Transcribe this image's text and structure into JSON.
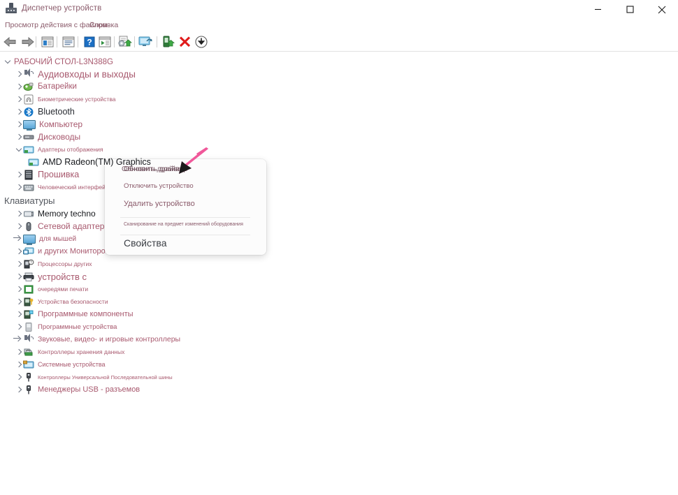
{
  "window": {
    "title": "Диспетчер устройств",
    "icon": "device-manager-icon",
    "controls": {
      "minimize": "–",
      "maximize": "□",
      "close": "✕"
    }
  },
  "menubar": {
    "items": [
      {
        "label": "Просмотр действия с файлом"
      },
      {
        "label": "Справка"
      }
    ]
  },
  "toolbar": {
    "buttons": [
      {
        "name": "back-button",
        "icon": "back-arrow-icon"
      },
      {
        "name": "forward-button",
        "icon": "forward-arrow-icon"
      },
      {
        "name": "show-hidden-devices-button",
        "icon": "list-view-icon"
      },
      {
        "name": "properties-button",
        "icon": "properties-icon"
      },
      {
        "name": "help-button",
        "icon": "help-question-icon"
      },
      {
        "name": "devices-by-type-button",
        "icon": "devices-list-icon"
      },
      {
        "name": "update-driver-button",
        "icon": "update-driver-icon"
      },
      {
        "name": "scan-hardware-button",
        "icon": "scan-monitor-icon"
      },
      {
        "name": "disable-device-button",
        "icon": "disable-device-icon"
      },
      {
        "name": "uninstall-device-button",
        "icon": "red-x-icon"
      },
      {
        "name": "download-button",
        "icon": "download-circle-icon"
      }
    ]
  },
  "tree": {
    "root": {
      "label": "РАБОЧИЙ СТОЛ-L3N388G",
      "expanded": true
    },
    "items": [
      {
        "label": "Аудиовходы и выходы",
        "icon": "speaker-icon",
        "marker": "chevron-right",
        "size": 13.5,
        "color": "#a8596e"
      },
      {
        "label": "Батарейки",
        "icon": "battery-icon",
        "marker": "chevron-right",
        "size": 11.5,
        "color": "#a8596e"
      },
      {
        "label": "Биометрические устройства",
        "icon": "fingerprint-icon",
        "marker": "chevron-right",
        "size": 8.5,
        "color": "#a8596e"
      },
      {
        "label": "Bluetooth",
        "icon": "bluetooth-icon",
        "marker": "chevron-right",
        "size": 12.5,
        "color": "#2a2d33"
      },
      {
        "label": "Компьютер",
        "icon": "computer-icon",
        "marker": "chevron-right",
        "size": 12,
        "color": "#a8596e"
      },
      {
        "label": "Дисководы",
        "icon": "disk-drive-icon",
        "marker": "chevron-right",
        "size": 12,
        "color": "#a8596e"
      },
      {
        "label": "Адаптеры отображения",
        "icon": "display-adapter-icon",
        "marker": "chevron-down",
        "size": 8.5,
        "color": "#a8596e"
      },
      {
        "label": "AMD Radeon(TM) Graphics",
        "icon": "display-adapter-icon",
        "marker": "none",
        "size": 12.5,
        "color": "#16181c",
        "selected": true
      },
      {
        "label": "Прошивка",
        "icon": "firmware-icon",
        "marker": "chevron-right",
        "size": 12.5,
        "color": "#a8596e"
      },
      {
        "label": "Человеческий интерфейс",
        "icon": "hid-icon",
        "marker": "chevron-right",
        "size": 8.5,
        "color": "#a8596e"
      },
      {
        "label": "Клавиатуры",
        "icon": "none",
        "marker": "none",
        "size": 13,
        "color": "#54585f"
      },
      {
        "label": "Memory techno",
        "icon": "memory-icon",
        "marker": "chevron-right",
        "size": 12,
        "color": "#16181c"
      },
      {
        "label": "Сетевой адаптер",
        "icon": "mouse-icon",
        "marker": "chevron-right",
        "size": 12,
        "color": "#a8596e"
      },
      {
        "label": "для мышей",
        "icon": "monitor-icon",
        "marker": "double-chevron",
        "size": 10,
        "color": "#a8596e"
      },
      {
        "label": "и других Мониторов",
        "icon": "monitor-blue-icon",
        "marker": "chevron-right",
        "size": 11,
        "color": "#a8596e"
      },
      {
        "label": "Процессоры других",
        "icon": "processor-icon",
        "marker": "chevron-right",
        "size": 8.5,
        "color": "#a8596e"
      },
      {
        "label": "устройств с",
        "icon": "printer-icon",
        "marker": "chevron-right",
        "size": 13,
        "color": "#a8596e"
      },
      {
        "label": "очередями печати",
        "icon": "print-queue-icon",
        "marker": "chevron-right",
        "size": 8.5,
        "color": "#a8596e"
      },
      {
        "label": "Устройства безопасности",
        "icon": "security-device-icon",
        "marker": "chevron-right",
        "size": 8.5,
        "color": "#a8596e"
      },
      {
        "label": "Программные компоненты",
        "icon": "software-component-icon",
        "marker": "chevron-right",
        "size": 11,
        "color": "#a8596e"
      },
      {
        "label": "Программные устройства",
        "icon": "software-device-icon",
        "marker": "chevron-right",
        "size": 9.5,
        "color": "#a8596e"
      },
      {
        "label": "Звуковые, видео- и игровые контроллеры",
        "icon": "speaker-icon",
        "marker": "double-chevron",
        "size": 10.5,
        "color": "#a8596e"
      },
      {
        "label": "Контроллеры хранения данных",
        "icon": "storage-controller-icon",
        "marker": "chevron-right",
        "size": 8.5,
        "color": "#a8596e"
      },
      {
        "label": "Системные устройства",
        "icon": "system-device-icon",
        "marker": "chevron-right",
        "size": 9,
        "color": "#a8596e"
      },
      {
        "label": "Контроллеры Универсальной Последовательной шины",
        "icon": "usb-icon",
        "marker": "chevron-right",
        "size": 7.5,
        "color": "#a8596e"
      },
      {
        "label": "Менеджеры USB - разъемов",
        "icon": "usb-icon",
        "marker": "chevron-right",
        "size": 11,
        "color": "#a8596e"
      }
    ]
  },
  "context_menu": {
    "items": [
      {
        "label": "Обновить драйвер",
        "overlap_label": "Обновить драйвер",
        "size": 10.5,
        "name": "update-driver-menu-item"
      },
      {
        "label": "Отключить устройство",
        "size": 9.5,
        "name": "disable-device-menu-item"
      },
      {
        "label": "Удалить устройство",
        "size": 11,
        "name": "uninstall-device-menu-item"
      },
      {
        "label": "Сканирование на предмет изменений оборудования",
        "size": 7,
        "name": "scan-hardware-menu-item"
      },
      {
        "label": "Свойства",
        "size": 14,
        "name": "properties-menu-item"
      }
    ]
  },
  "annotation": {
    "arrow": {
      "name": "pointer-arrow",
      "color": "#f0589a",
      "tip_color": "#1c1c1c"
    }
  },
  "colors": {
    "accent_text": "#a8596e",
    "title_text": "#8a5a6a",
    "selection": "#b5d4f0",
    "arrow_pink": "#f0589a"
  }
}
